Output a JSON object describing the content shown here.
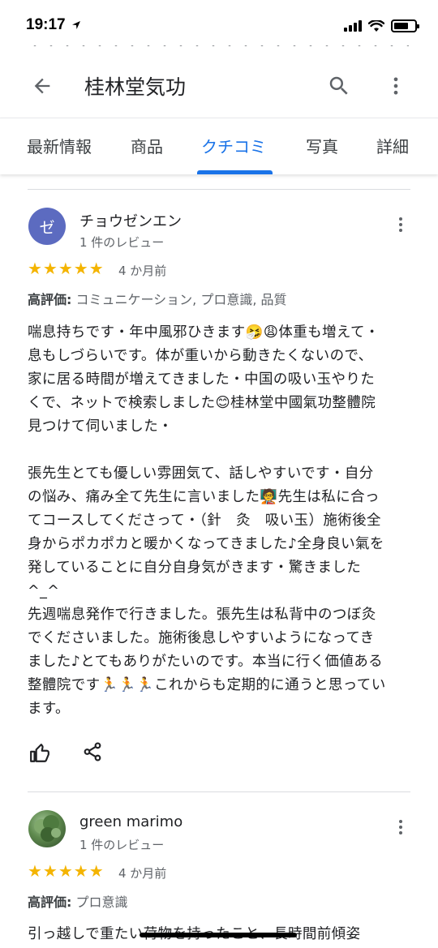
{
  "status_bar": {
    "time": "19:17"
  },
  "header": {
    "cut_text": "・・・・・・・・・・・・・・・・・・・・・・・・・・・・",
    "title": "桂林堂気功"
  },
  "tabs": [
    {
      "label": "最新情報"
    },
    {
      "label": "商品"
    },
    {
      "label": "クチコミ"
    },
    {
      "label": "写真"
    },
    {
      "label": "詳細"
    }
  ],
  "reviews": [
    {
      "avatar_letter": "ゼ",
      "name": "チョウゼンエン",
      "review_count": "1 件のレビュー",
      "stars": "★★★★★",
      "rating": 5,
      "date": "4 か月前",
      "highlights_label": "高評価:",
      "highlights": "コミュニケーション, プロ意識, 品質",
      "body": "喘息持ちです・年中風邪ひきます🤧😩体重も増えて・息もしづらいです。体が重いから動きたくないので、家に居る時間が増えてきました・中国の吸い玉やりたくで、ネットで検索しました😊桂林堂中國氣功整體院見つけて伺いました・\n\n張先生とても優しい雰囲気て、話しやすいです・自分の悩み、痛み全て先生に言いました🧑‍🏫先生は私に合ってコースしてくださって・（針　灸　吸い玉）施術後全身からポカポカと暖かくなってきました♪全身良い氣を発していることに自分自身気がきます・驚きました^_^\n先週喘息発作で行きました。張先生は私背中のつぼ灸でくださいました。施術後息しやすいようになってきました♪とてもありがたいのです。本当に行く価値ある整體院です🏃🏃🏃これからも定期的に通うと思っています。"
    },
    {
      "avatar_letter": "",
      "name": "green marimo",
      "review_count": "1 件のレビュー",
      "stars": "★★★★★",
      "rating": 5,
      "date": "4 か月前",
      "highlights_label": "高評価:",
      "highlights": "プロ意識",
      "body": "引っ越しで重たい荷物を持ったこと、長時間前傾姿"
    }
  ],
  "colors": {
    "accent": "#1a73e8",
    "star": "#f4b400",
    "avatar": "#5c6bc0"
  },
  "icons": [
    "arrow-back-icon",
    "search-icon",
    "more-vert-icon",
    "thumb-up-icon",
    "share-icon"
  ]
}
